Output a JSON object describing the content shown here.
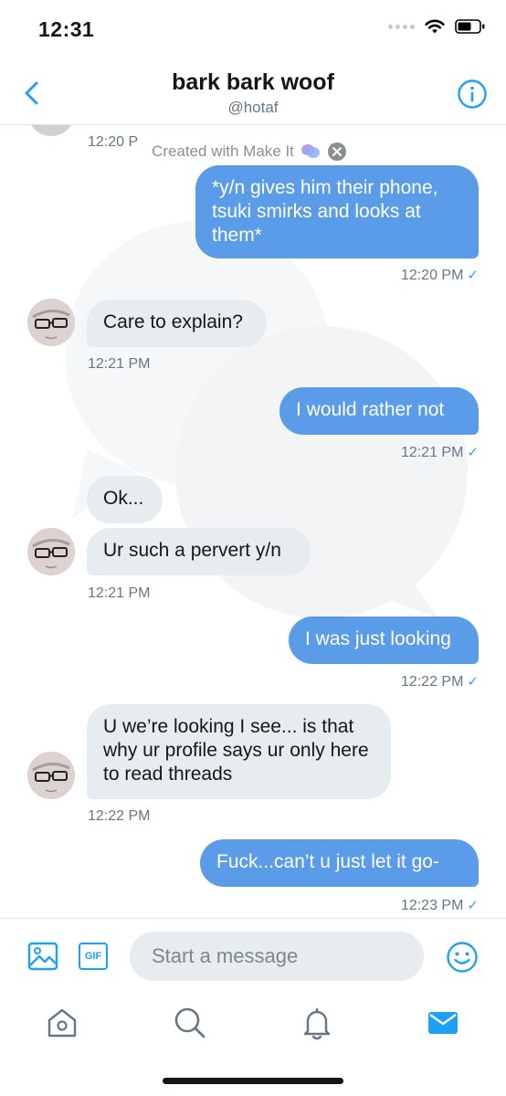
{
  "status": {
    "time": "12:31"
  },
  "header": {
    "title": "bark bark woof",
    "handle": "@hotaf"
  },
  "watermark": {
    "text": "Created with Make It"
  },
  "colors": {
    "accent": "#1da1f2",
    "outgoing_bubble": "#5b9ce8",
    "incoming_bubble": "#e6ecf0"
  },
  "messages": [
    {
      "direction": "in",
      "text": "",
      "time": "12:20 P"
    },
    {
      "direction": "out",
      "text": "*y/n gives him their phone, tsuki smirks and looks at them*",
      "time": "12:20 PM"
    },
    {
      "direction": "in",
      "text": "Care to explain?",
      "time": "12:21 PM"
    },
    {
      "direction": "out",
      "text": "I would rather not",
      "time": "12:21 PM"
    },
    {
      "direction": "in",
      "text": "Ok...",
      "time": ""
    },
    {
      "direction": "in",
      "text": "Ur such a pervert y/n",
      "time": "12:21 PM"
    },
    {
      "direction": "out",
      "text": "I was just looking",
      "time": "12:22 PM"
    },
    {
      "direction": "in",
      "text": "U we’re looking I see... is that why ur profile says ur only here to read threads",
      "time": "12:22 PM"
    },
    {
      "direction": "out",
      "text": "Fuck...can’t u just let it go-",
      "time": "12:23 PM"
    }
  ],
  "read_mark": "✓",
  "composer": {
    "placeholder": "Start a message",
    "gif_label": "GIF"
  },
  "tabs": [
    "home-icon",
    "search-icon",
    "notifications-icon",
    "messages-icon"
  ]
}
